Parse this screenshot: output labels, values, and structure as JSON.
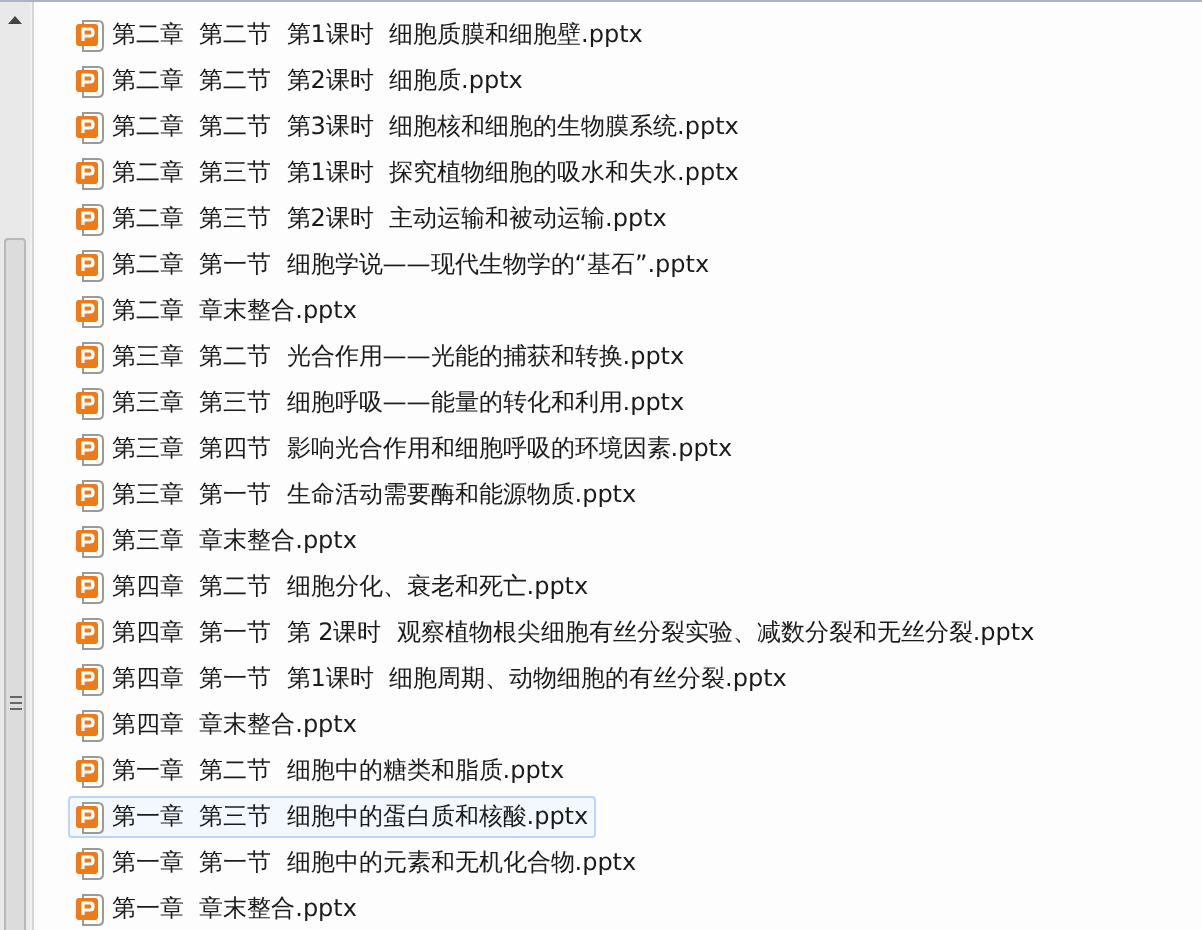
{
  "files": [
    {
      "name": "第二章  第二节  第1课时  细胞质膜和细胞壁.pptx",
      "hovered": false
    },
    {
      "name": "第二章  第二节  第2课时  细胞质.pptx",
      "hovered": false
    },
    {
      "name": "第二章  第二节  第3课时  细胞核和细胞的生物膜系统.pptx",
      "hovered": false
    },
    {
      "name": "第二章  第三节  第1课时  探究植物细胞的吸水和失水.pptx",
      "hovered": false
    },
    {
      "name": "第二章  第三节  第2课时  主动运输和被动运输.pptx",
      "hovered": false
    },
    {
      "name": "第二章  第一节  细胞学说——现代生物学的“基石”.pptx",
      "hovered": false
    },
    {
      "name": "第二章  章末整合.pptx",
      "hovered": false
    },
    {
      "name": "第三章  第二节  光合作用——光能的捕获和转换.pptx",
      "hovered": false
    },
    {
      "name": "第三章  第三节  细胞呼吸——能量的转化和利用.pptx",
      "hovered": false
    },
    {
      "name": "第三章  第四节  影响光合作用和细胞呼吸的环境因素.pptx",
      "hovered": false
    },
    {
      "name": "第三章  第一节  生命活动需要酶和能源物质.pptx",
      "hovered": false
    },
    {
      "name": "第三章  章末整合.pptx",
      "hovered": false
    },
    {
      "name": "第四章  第二节  细胞分化、衰老和死亡.pptx",
      "hovered": false
    },
    {
      "name": "第四章  第一节  第 2课时  观察植物根尖细胞有丝分裂实验、减数分裂和无丝分裂.pptx",
      "hovered": false
    },
    {
      "name": "第四章  第一节  第1课时  细胞周期、动物细胞的有丝分裂.pptx",
      "hovered": false
    },
    {
      "name": "第四章  章末整合.pptx",
      "hovered": false
    },
    {
      "name": "第一章  第二节  细胞中的糖类和脂质.pptx",
      "hovered": false
    },
    {
      "name": "第一章  第三节  细胞中的蛋白质和核酸.pptx",
      "hovered": true
    },
    {
      "name": "第一章  第一节  细胞中的元素和无机化合物.pptx",
      "hovered": false
    },
    {
      "name": "第一章  章末整合.pptx",
      "hovered": false
    }
  ]
}
